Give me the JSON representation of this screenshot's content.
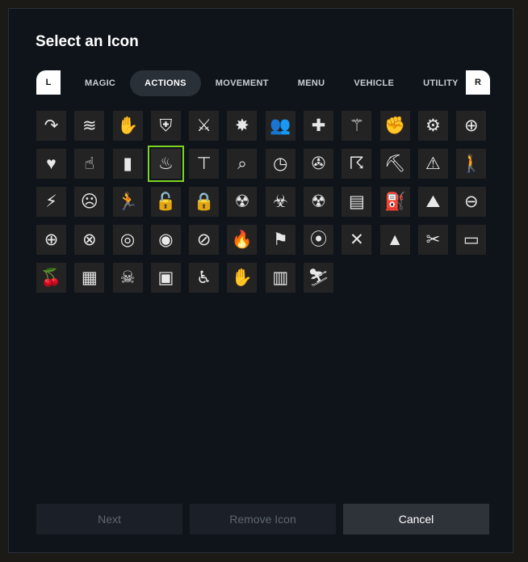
{
  "dialog": {
    "title": "Select an Icon",
    "bumper_left": "L",
    "bumper_right": "R"
  },
  "tabs": [
    {
      "label": "MAGIC"
    },
    {
      "label": "ACTIONS",
      "active": true
    },
    {
      "label": "MOVEMENT"
    },
    {
      "label": "MENU"
    },
    {
      "label": "VEHICLE"
    },
    {
      "label": "UTILITY"
    }
  ],
  "selection_color": "#7ed321",
  "icons": [
    {
      "name": "arc-arrow-icon",
      "glyph": "↷"
    },
    {
      "name": "swipe-lines-icon",
      "glyph": "≋"
    },
    {
      "name": "grab-hand-icon",
      "glyph": "✋"
    },
    {
      "name": "shield-slash-icon",
      "glyph": "⛨"
    },
    {
      "name": "crossed-swords-icon",
      "glyph": "⚔"
    },
    {
      "name": "sparkle-burst-icon",
      "glyph": "✸"
    },
    {
      "name": "group-people-icon",
      "glyph": "👥"
    },
    {
      "name": "plus-cross-icon",
      "glyph": "✚"
    },
    {
      "name": "magic-wand-icon",
      "glyph": "⚚"
    },
    {
      "name": "fist-burst-icon",
      "glyph": "✊"
    },
    {
      "name": "robot-figure-icon",
      "glyph": "⚙"
    },
    {
      "name": "zoom-in-icon",
      "glyph": "⊕"
    },
    {
      "name": "heart-icon",
      "glyph": "♥"
    },
    {
      "name": "pointing-hand-icon",
      "glyph": "☝"
    },
    {
      "name": "battery-charging-icon",
      "glyph": "▮"
    },
    {
      "name": "cooking-pot-icon",
      "glyph": "♨",
      "selected": true
    },
    {
      "name": "crane-icon",
      "glyph": "⊤"
    },
    {
      "name": "binoculars-figure-icon",
      "glyph": "⌕"
    },
    {
      "name": "timer-icon",
      "glyph": "◷"
    },
    {
      "name": "compass-icon",
      "glyph": "✇"
    },
    {
      "name": "falling-person-icon",
      "glyph": "☈"
    },
    {
      "name": "digging-person-icon",
      "glyph": "⛏"
    },
    {
      "name": "warning-triangle-icon",
      "glyph": "⚠"
    },
    {
      "name": "standing-person-icon",
      "glyph": "🚶"
    },
    {
      "name": "crack-icon",
      "glyph": "⚡"
    },
    {
      "name": "cover-ears-icon",
      "glyph": "☹"
    },
    {
      "name": "running-exit-icon",
      "glyph": "🏃"
    },
    {
      "name": "unlocked-padlock-icon",
      "glyph": "🔓"
    },
    {
      "name": "locked-padlock-icon",
      "glyph": "🔒"
    },
    {
      "name": "radiation-circle-icon",
      "glyph": "☢"
    },
    {
      "name": "biohazard-icon",
      "glyph": "☣"
    },
    {
      "name": "radiation-icon",
      "glyph": "☢"
    },
    {
      "name": "cash-stack-icon",
      "glyph": "▤"
    },
    {
      "name": "fuel-pumps-icon",
      "glyph": "⛽"
    },
    {
      "name": "mountains-icon",
      "glyph": "⛰"
    },
    {
      "name": "zoom-out-icon",
      "glyph": "⊖"
    },
    {
      "name": "magnifier-plus-icon",
      "glyph": "⊕"
    },
    {
      "name": "magnifier-cross-icon",
      "glyph": "⊗"
    },
    {
      "name": "eye-outline-icon",
      "glyph": "◎"
    },
    {
      "name": "eye-icon",
      "glyph": "◉"
    },
    {
      "name": "eye-hidden-icon",
      "glyph": "⊘"
    },
    {
      "name": "campfire-icon",
      "glyph": "🔥"
    },
    {
      "name": "hikers-icon",
      "glyph": "⚑"
    },
    {
      "name": "pointer-target-icon",
      "glyph": "⦿"
    },
    {
      "name": "fork-knife-icon",
      "glyph": "✕"
    },
    {
      "name": "tent-icon",
      "glyph": "▲"
    },
    {
      "name": "cut-line-icon",
      "glyph": "✂"
    },
    {
      "name": "bed-icon",
      "glyph": "▭"
    },
    {
      "name": "fruit-branch-icon",
      "glyph": "🍒"
    },
    {
      "name": "trash-bin-hand-icon",
      "glyph": "▦"
    },
    {
      "name": "gas-mask-icon",
      "glyph": "☠"
    },
    {
      "name": "cassette-tape-icon",
      "glyph": "▣"
    },
    {
      "name": "seated-person-icon",
      "glyph": "♿"
    },
    {
      "name": "hand-holding-icon",
      "glyph": "✋"
    },
    {
      "name": "folded-map-icon",
      "glyph": "▥"
    },
    {
      "name": "person-slope-icon",
      "glyph": "⛷"
    }
  ],
  "footer": {
    "next_label": "Next",
    "remove_label": "Remove Icon",
    "cancel_label": "Cancel"
  }
}
